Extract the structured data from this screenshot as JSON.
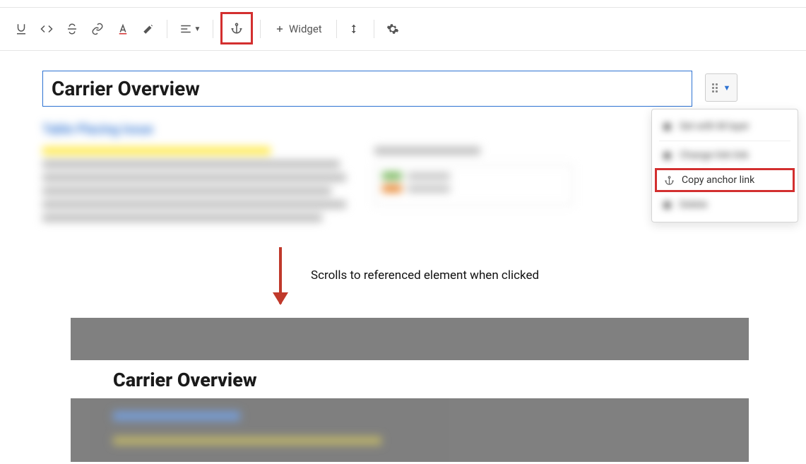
{
  "toolbar": {
    "widget_label": "Widget"
  },
  "editor": {
    "title": "Carrier Overview"
  },
  "context_menu": {
    "copy_anchor_label": "Copy anchor link"
  },
  "annotation": {
    "text": "Scrolls to referenced element when clicked"
  },
  "viewer": {
    "heading": "Carrier Overview"
  }
}
